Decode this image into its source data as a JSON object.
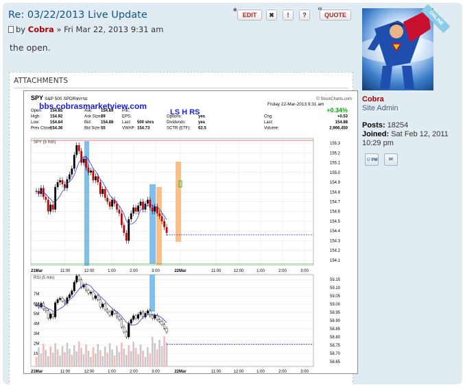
{
  "post": {
    "title": "Re: 03/22/2013 Live Update",
    "by_prefix": "by",
    "author": "Cobra",
    "date_text": "» Fri Mar 22, 2013 9:31 am",
    "content": "the open.",
    "buttons": {
      "edit": "EDIT",
      "delete": "✖",
      "report": "!",
      "info": "?",
      "quote": "QUOTE"
    },
    "attachments_title": "ATTACHMENTS"
  },
  "profile": {
    "online_badge": "ONLINE",
    "username": "Cobra",
    "rank": "Site Admin",
    "posts_label": "Posts:",
    "posts_value": "18254",
    "joined_label": "Joined:",
    "joined_value": "Sat Feb 12, 2011 10:29 pm",
    "pm_label": "PM"
  },
  "chart_header": {
    "symbol": "SPY",
    "description": "S&P 500 SPDRs",
    "exchange": "NYSE",
    "watermark": "© StockCharts.com",
    "site": "bbs.cobrasmarketview.com",
    "stamp": "Friday  22-Mar-2013  9:31 am",
    "change_pct": "+0.34%",
    "lshrs": "LS H RS",
    "rows": [
      [
        "Open:",
        "154.85",
        "Ask:",
        "154.89",
        "P/E:",
        "",
        "",
        "",
        "",
        ""
      ],
      [
        "High:",
        "154.92",
        "Ask Size:",
        "89",
        "EPS:",
        "",
        "Options:",
        "yes",
        "Chg:",
        "+0.53"
      ],
      [
        "Low:",
        "154.84",
        "Bid:",
        "154.88",
        "Last:",
        "500 shrs",
        "Dividends:",
        "yes",
        "Last:",
        "154.88"
      ],
      [
        "Prev Close:",
        "154.36",
        "Bid Size:",
        "55",
        "VWAP:",
        "154.73",
        "SCTR (ETF):",
        "62.5",
        "Volume:",
        "2,966,450"
      ]
    ]
  },
  "chart_data": [
    {
      "type": "line",
      "title": "SPY (5 min)",
      "ylim": [
        154.05,
        155.35
      ],
      "y_ticks": [
        "155.3",
        "155.2",
        "155.1",
        "155.0",
        "154.9",
        "154.8",
        "154.7",
        "154.6",
        "154.5",
        "154.4",
        "154.3",
        "154.2",
        "154.1"
      ],
      "x_ticks": [
        "21Mar",
        "11:00",
        "12:00",
        "1:00",
        "2:00",
        "3:00",
        "22Mar",
        "11:00",
        "12:00",
        "1:00",
        "2:00",
        "3:00"
      ],
      "series": [
        {
          "name": "SPY (5 min)",
          "values": [
            154.81,
            154.78,
            154.84,
            154.75,
            154.72,
            154.6,
            154.67,
            154.62,
            154.85,
            154.9,
            154.92,
            154.88,
            154.84,
            154.93,
            154.98,
            155.04,
            155.18,
            155.28,
            155.22,
            155.1,
            155.14,
            155.05,
            155.0,
            155.02,
            154.92,
            154.96,
            154.9,
            154.78,
            154.83,
            154.74,
            154.7,
            154.65,
            154.72,
            154.68,
            154.62,
            154.58,
            154.46,
            154.38,
            154.3,
            154.52,
            154.58,
            154.64,
            154.6,
            154.66,
            154.7,
            154.62,
            154.68,
            154.72,
            154.64,
            154.6,
            154.65,
            154.58,
            154.55,
            154.5,
            154.44,
            154.38
          ]
        }
      ],
      "reference_line": 154.36,
      "last_price": 154.88
    },
    {
      "type": "bar",
      "title": "RSI (5 min)",
      "ylim": [
        58.62,
        59.18
      ],
      "y_ticks": [
        "59.15",
        "59.10",
        "59.05",
        "59.00",
        "58.95",
        "58.90",
        "58.85",
        "58.80",
        "58.75",
        "58.70",
        "58.65"
      ],
      "volume_ticks": [
        "7M",
        "6M",
        "5M",
        "4M",
        "3M",
        "2M",
        "1M"
      ],
      "x_ticks": [
        "21Mar",
        "11:00",
        "12:00",
        "1:00",
        "2:00",
        "3:00",
        "22Mar",
        "11:00",
        "12:00",
        "1:00",
        "2:00",
        "3:00"
      ],
      "reference_line": 58.755
    }
  ],
  "colors": {
    "title": "#105289",
    "author": "#aa0000",
    "up": "#00aa00",
    "down": "#cc0000",
    "highlight_blue": "#5aa9e6",
    "highlight_orange": "#f6b26b"
  }
}
